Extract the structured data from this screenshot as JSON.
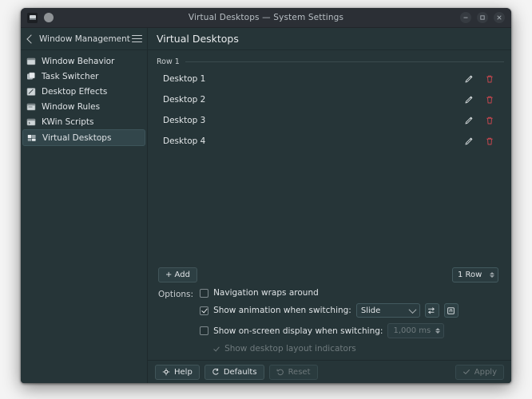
{
  "window": {
    "title": "Virtual Desktops — System Settings",
    "app_icon": "settings-app-icon",
    "controls": {
      "minimize": "minimize-icon",
      "maximize": "maximize-icon",
      "close": "close-icon"
    }
  },
  "header": {
    "back_label": "Window Management",
    "menu_icon": "hamburger-menu-icon",
    "page_title": "Virtual Desktops"
  },
  "sidebar": {
    "items": [
      {
        "label": "Window Behavior",
        "icon": "window-icon",
        "selected": false
      },
      {
        "label": "Task Switcher",
        "icon": "task-switcher-icon",
        "selected": false
      },
      {
        "label": "Desktop Effects",
        "icon": "effects-icon",
        "selected": false
      },
      {
        "label": "Window Rules",
        "icon": "window-rules-icon",
        "selected": false
      },
      {
        "label": "KWin Scripts",
        "icon": "kwin-scripts-icon",
        "selected": false
      },
      {
        "label": "Virtual Desktops",
        "icon": "virtual-desktops-icon",
        "selected": true
      }
    ]
  },
  "main": {
    "row_legend": "Row 1",
    "desktops": [
      {
        "name": "Desktop 1"
      },
      {
        "name": "Desktop 2"
      },
      {
        "name": "Desktop 3"
      },
      {
        "name": "Desktop 4"
      }
    ],
    "rename_icon": "pencil-icon",
    "delete_icon": "trash-icon",
    "add_button": "+ Add",
    "rows_spinner": {
      "value": "1 Row"
    },
    "options": {
      "label": "Options:",
      "nav_wraps": {
        "label": "Navigation wraps around",
        "checked": false
      },
      "animation": {
        "label": "Show animation when switching:",
        "checked": true,
        "selected": "Slide",
        "config_icon": "sliders-icon",
        "about_icon": "info-box-icon"
      },
      "osd": {
        "label": "Show on-screen display when switching:",
        "checked": false,
        "duration": "1,000 ms"
      },
      "layout_indicators": {
        "label": "Show desktop layout indicators",
        "checked": true,
        "enabled": false
      }
    }
  },
  "footer": {
    "help": "Help",
    "defaults": "Defaults",
    "reset": "Reset",
    "apply": "Apply",
    "help_icon": "help-icon",
    "defaults_icon": "defaults-icon",
    "reset_icon": "reset-icon",
    "apply_icon": "check-icon"
  },
  "colors": {
    "window_bg": "#263538",
    "titlebar_bg": "#2b2f35",
    "accent_selected": "#32464b",
    "delete_red": "#c9474f",
    "text": "#dfe3e6",
    "text_muted": "#6f7a7d"
  }
}
